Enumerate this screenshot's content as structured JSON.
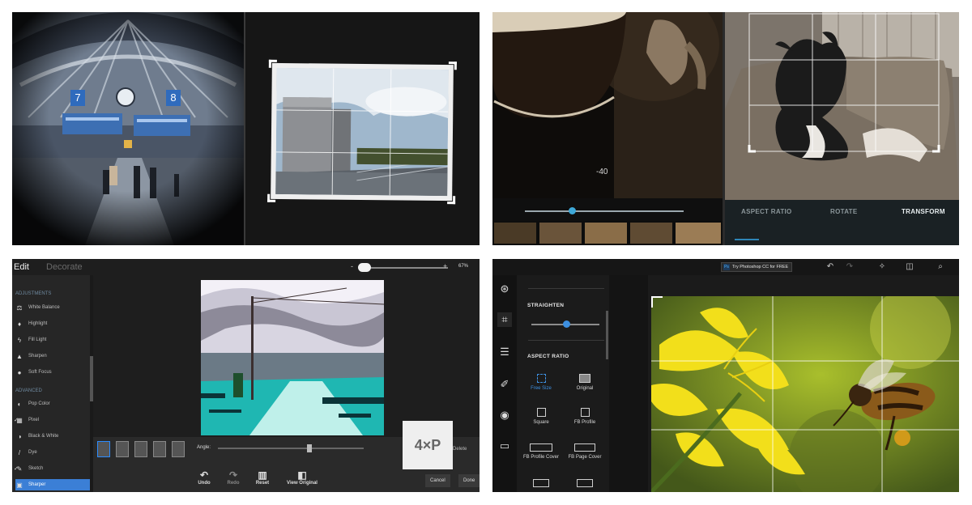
{
  "panel_top_left": {
    "station_signs": [
      "7",
      "8"
    ]
  },
  "panel_top_right": {
    "adjust_value": "-40",
    "tabs": [
      "ASPECT RATIO",
      "ROTATE",
      "TRANSFORM"
    ],
    "active_tab": "TRANSFORM",
    "colors": {
      "slider_accent": "#3ea8d8"
    }
  },
  "panel_bottom_left": {
    "mode_tabs": [
      "Edit",
      "Decorate"
    ],
    "zoom_minus": "-",
    "zoom_plus": "+",
    "zoom_percent": "67%",
    "sections": [
      {
        "title": "ADJUSTMENTS",
        "items": [
          "White Balance",
          "Highlight",
          "Fill Light",
          "Sharpen",
          "Soft Focus"
        ]
      },
      {
        "title": "ADVANCED",
        "items": [
          "Pop Color",
          "Pixel",
          "Black & White",
          "Dye",
          "Sketch",
          "Sharper"
        ]
      }
    ],
    "angle_label": "Angle:",
    "tools": [
      "Undo",
      "Redo",
      "Reset",
      "View Original"
    ],
    "buttons": [
      "Cancel",
      "Done"
    ],
    "watermark": "4×P",
    "watermark_side_text": "Delete"
  },
  "panel_bottom_right": {
    "try_button": "Try Photoshop CC for FREE",
    "straighten_label": "STRAIGHTEN",
    "aspect_label": "ASPECT RATIO",
    "ratios": [
      "Free Size",
      "Original",
      "Square",
      "FB Profile",
      "FB Profile Cover",
      "FB Page Cover"
    ],
    "active_ratio": "Free Size",
    "straighten_value": 0.5,
    "colors": {
      "accent": "#3d8fe0"
    }
  }
}
